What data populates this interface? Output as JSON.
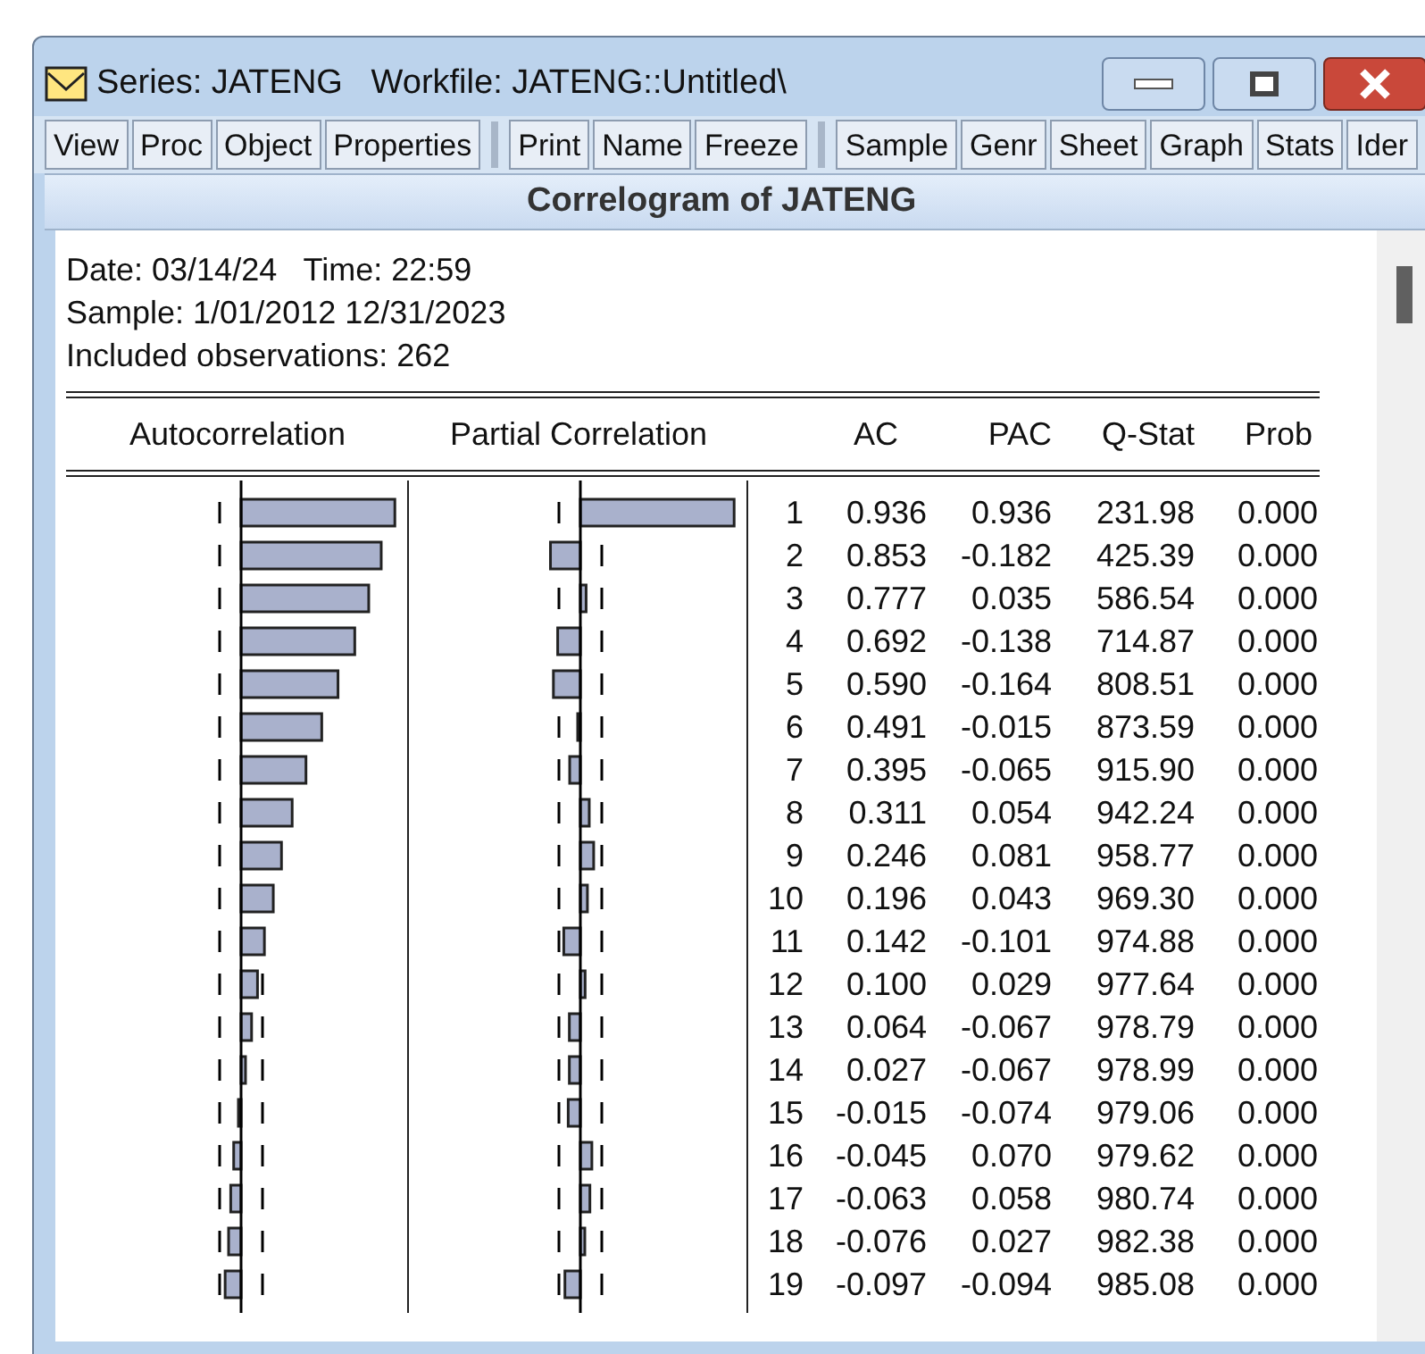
{
  "window": {
    "title": "Series: JATENG   Workfile: JATENG::Untitled\\"
  },
  "toolbar_groups": [
    [
      "View",
      "Proc",
      "Object",
      "Properties"
    ],
    [
      "Print",
      "Name",
      "Freeze"
    ],
    [
      "Sample",
      "Genr",
      "Sheet",
      "Graph",
      "Stats",
      "Ider"
    ]
  ],
  "view_title": "Correlogram of JATENG",
  "info_lines": [
    "Date: 03/14/24   Time: 22:59",
    "Sample: 1/01/2012 12/31/2023",
    "Included observations: 262"
  ],
  "columns": [
    "Autocorrelation",
    "Partial Correlation",
    "AC",
    "PAC",
    "Q-Stat",
    "Prob"
  ],
  "rows": [
    {
      "lag": "1",
      "ac": "0.936",
      "pac": "0.936",
      "q_stat": "231.98",
      "prob": "0.000"
    },
    {
      "lag": "2",
      "ac": "0.853",
      "pac": "-0.182",
      "q_stat": "425.39",
      "prob": "0.000"
    },
    {
      "lag": "3",
      "ac": "0.777",
      "pac": "0.035",
      "q_stat": "586.54",
      "prob": "0.000"
    },
    {
      "lag": "4",
      "ac": "0.692",
      "pac": "-0.138",
      "q_stat": "714.87",
      "prob": "0.000"
    },
    {
      "lag": "5",
      "ac": "0.590",
      "pac": "-0.164",
      "q_stat": "808.51",
      "prob": "0.000"
    },
    {
      "lag": "6",
      "ac": "0.491",
      "pac": "-0.015",
      "q_stat": "873.59",
      "prob": "0.000"
    },
    {
      "lag": "7",
      "ac": "0.395",
      "pac": "-0.065",
      "q_stat": "915.90",
      "prob": "0.000"
    },
    {
      "lag": "8",
      "ac": "0.311",
      "pac": "0.054",
      "q_stat": "942.24",
      "prob": "0.000"
    },
    {
      "lag": "9",
      "ac": "0.246",
      "pac": "0.081",
      "q_stat": "958.77",
      "prob": "0.000"
    },
    {
      "lag": "10",
      "ac": "0.196",
      "pac": "0.043",
      "q_stat": "969.30",
      "prob": "0.000"
    },
    {
      "lag": "11",
      "ac": "0.142",
      "pac": "-0.101",
      "q_stat": "974.88",
      "prob": "0.000"
    },
    {
      "lag": "12",
      "ac": "0.100",
      "pac": "0.029",
      "q_stat": "977.64",
      "prob": "0.000"
    },
    {
      "lag": "13",
      "ac": "0.064",
      "pac": "-0.067",
      "q_stat": "978.79",
      "prob": "0.000"
    },
    {
      "lag": "14",
      "ac": "0.027",
      "pac": "-0.067",
      "q_stat": "978.99",
      "prob": "0.000"
    },
    {
      "lag": "15",
      "ac": "-0.015",
      "pac": "-0.074",
      "q_stat": "979.06",
      "prob": "0.000"
    },
    {
      "lag": "16",
      "ac": "-0.045",
      "pac": "0.070",
      "q_stat": "979.62",
      "prob": "0.000"
    },
    {
      "lag": "17",
      "ac": "-0.063",
      "pac": "0.058",
      "q_stat": "980.74",
      "prob": "0.000"
    },
    {
      "lag": "18",
      "ac": "-0.076",
      "pac": "0.027",
      "q_stat": "982.38",
      "prob": "0.000"
    },
    {
      "lag": "19",
      "ac": "-0.097",
      "pac": "-0.094",
      "q_stat": "985.08",
      "prob": "0.000"
    }
  ]
}
